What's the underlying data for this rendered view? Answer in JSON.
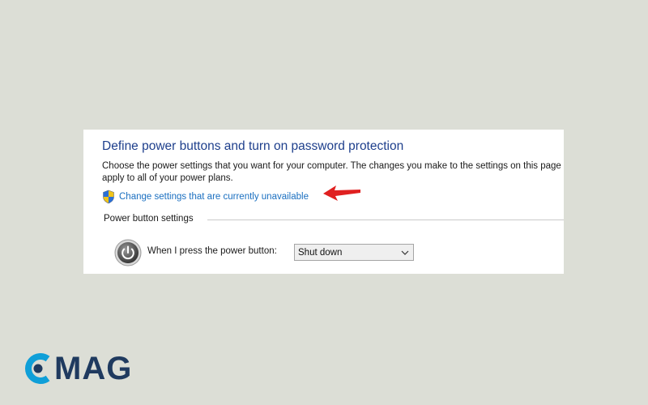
{
  "panel": {
    "title": "Define power buttons and turn on password protection",
    "description": "Choose the power settings that you want for your computer. The changes you make to the settings on this page apply to all of your power plans.",
    "change_link": "Change settings that are currently unavailable",
    "section_label": "Power button settings",
    "power_button": {
      "label": "When I press the power button:",
      "selected": "Shut down"
    }
  },
  "icons": {
    "shield": "uac-shield-icon",
    "power": "power-icon",
    "arrow": "red-arrow-annotation",
    "dropdown": "chevron-down-icon"
  },
  "colors": {
    "title": "#1e3f8c",
    "link": "#1a6fc0",
    "arrow": "#e02020",
    "background": "#dcded6",
    "logo_accent": "#0f9fd8",
    "logo_text": "#1f3a5f"
  },
  "watermark": {
    "text": "MAG"
  }
}
